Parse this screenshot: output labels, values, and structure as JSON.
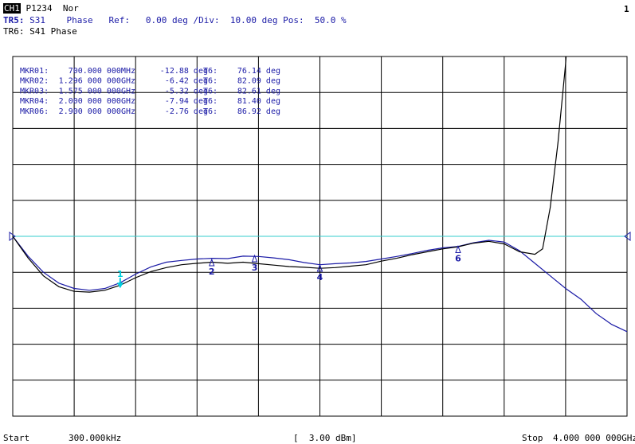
{
  "header": {
    "channel_badge": "CH1",
    "port_config": "P1234",
    "port_mode": "Nor",
    "trace_active_label": "TR5:",
    "trace_active_param": "S31",
    "trace_active_format": "Phase",
    "ref_label": "Ref:",
    "ref_value": "0.00 deg",
    "div_label": "/Div:",
    "div_value": "10.00 deg",
    "pos_label": "Pos:",
    "pos_value": "50.0 %",
    "trace_second": "TR6: S41 Phase",
    "window_number": "1"
  },
  "markers": [
    {
      "id": "MKR01:",
      "freq": "700.000 000MHz",
      "value": "-12.88 deg",
      "trace": "T6:",
      "value2": "76.14 deg"
    },
    {
      "id": "MKR02:",
      "freq": "1.296 000 000GHz",
      "value": "-6.42 deg",
      "trace": "T6:",
      "value2": "82.09 deg"
    },
    {
      "id": "MKR03:",
      "freq": "1.575 000 000GHz",
      "value": "-5.32 deg",
      "trace": "T6:",
      "value2": "82.61 deg"
    },
    {
      "id": "MKR04:",
      "freq": "2.000 000 000GHz",
      "value": "-7.94 deg",
      "trace": "T6:",
      "value2": "81.40 deg"
    },
    {
      "id": "MKR06:",
      "freq": "2.900 000 000GHz",
      "value": "-2.76 deg",
      "trace": "T6:",
      "value2": "86.92 deg"
    }
  ],
  "footer": {
    "start_label": "Start",
    "start_value": "300.000kHz",
    "power": "[  3.00 dBm]",
    "stop_label": "Stop",
    "stop_value": "4.000 000 000GHz"
  },
  "colors": {
    "trace_blue": "#1a1aa6",
    "trace_black": "#000000",
    "reference_line": "#33cccc",
    "active_marker": "#00d0e0",
    "grid": "#000000"
  },
  "chart_data": {
    "type": "line",
    "x_unit": "GHz",
    "y_unit": "deg",
    "xlim": [
      0.0003,
      4.0
    ],
    "ylim": [
      -50,
      50
    ],
    "reference_value": 0,
    "grid": true,
    "series": [
      {
        "name": "S31",
        "color": "#1a1aa6",
        "x": [
          0.0003,
          0.1,
          0.2,
          0.3,
          0.4,
          0.5,
          0.6,
          0.7,
          0.8,
          0.9,
          1.0,
          1.1,
          1.2,
          1.3,
          1.4,
          1.5,
          1.6,
          1.7,
          1.8,
          1.9,
          2.0,
          2.1,
          2.2,
          2.3,
          2.4,
          2.5,
          2.6,
          2.7,
          2.8,
          2.9,
          3.0,
          3.1,
          3.2,
          3.3,
          3.4,
          3.5,
          3.6,
          3.7,
          3.8,
          3.9,
          4.0
        ],
        "y": [
          0.0,
          -5.5,
          -10.0,
          -13.0,
          -14.5,
          -15.0,
          -14.5,
          -12.9,
          -10.5,
          -8.5,
          -7.2,
          -6.7,
          -6.3,
          -6.1,
          -6.2,
          -5.5,
          -5.6,
          -6.0,
          -6.5,
          -7.3,
          -7.9,
          -7.6,
          -7.4,
          -7.0,
          -6.3,
          -5.6,
          -4.8,
          -3.9,
          -3.2,
          -2.8,
          -1.8,
          -1.1,
          -1.6,
          -4.0,
          -7.5,
          -11.0,
          -14.5,
          -17.5,
          -21.5,
          -24.5,
          -26.5
        ]
      },
      {
        "name": "S41",
        "color": "#000000",
        "x": [
          0.0003,
          0.1,
          0.2,
          0.3,
          0.4,
          0.5,
          0.6,
          0.7,
          0.8,
          0.9,
          1.0,
          1.1,
          1.2,
          1.3,
          1.4,
          1.5,
          1.6,
          1.7,
          1.8,
          1.9,
          2.0,
          2.1,
          2.2,
          2.3,
          2.4,
          2.5,
          2.6,
          2.7,
          2.8,
          2.9,
          3.0,
          3.1,
          3.2,
          3.3,
          3.4,
          3.45,
          3.5,
          3.55,
          3.6,
          3.62
        ],
        "y": [
          0.0,
          -6.0,
          -11.0,
          -14.0,
          -15.3,
          -15.5,
          -15.0,
          -13.6,
          -11.5,
          -9.8,
          -8.7,
          -7.9,
          -7.5,
          -7.2,
          -7.5,
          -7.2,
          -7.6,
          -8.0,
          -8.4,
          -8.6,
          -8.9,
          -8.7,
          -8.3,
          -7.9,
          -6.9,
          -6.1,
          -5.1,
          -4.3,
          -3.5,
          -2.9,
          -1.9,
          -1.4,
          -2.1,
          -4.3,
          -5.0,
          -3.5,
          8.0,
          26.0,
          48.0,
          60.0
        ]
      }
    ],
    "marker_labels": [
      {
        "label": "1",
        "x": 0.7,
        "y": -12.88
      },
      {
        "label": "2",
        "x": 1.296,
        "y": -6.42
      },
      {
        "label": "3",
        "x": 1.575,
        "y": -5.32
      },
      {
        "label": "4",
        "x": 2.0,
        "y": -7.94
      },
      {
        "label": "6",
        "x": 2.9,
        "y": -2.76
      }
    ]
  }
}
